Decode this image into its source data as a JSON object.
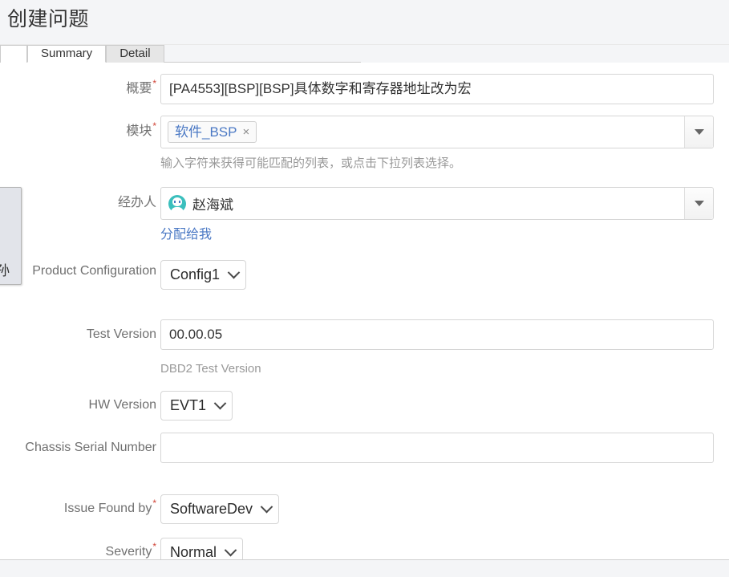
{
  "header": {
    "title": "创建问题"
  },
  "tabs": [
    {
      "label": "Summary",
      "active": true
    },
    {
      "label": "Detail",
      "active": false
    }
  ],
  "form": {
    "fields": [
      {
        "id": "summary",
        "label": "概要",
        "required": true,
        "type": "text",
        "value": "[PA4553][BSP][BSP]具体数字和寄存器地址改为宏",
        "placeholder": ""
      },
      {
        "id": "module",
        "label": "模块",
        "required": true,
        "type": "tokens",
        "chip": "软件_BSP",
        "chip_remove": "×",
        "hint": "输入字符来获得可能匹配的列表，或点击下拉列表选择。"
      },
      {
        "id": "assignee",
        "label": "经办人",
        "required": false,
        "type": "picker",
        "value": "赵海斌",
        "link": "分配给我"
      },
      {
        "id": "product-configuration",
        "label": "Product Configuration",
        "required": false,
        "type": "select",
        "value": "Config1"
      },
      {
        "id": "test-version",
        "label": "Test Version",
        "required": false,
        "type": "text",
        "value": "00.00.05",
        "hint": "DBD2 Test Version"
      },
      {
        "id": "hw-version",
        "label": "HW Version",
        "required": false,
        "type": "select",
        "value": "EVT1"
      },
      {
        "id": "chassis-serial-number",
        "label": "Chassis Serial Number",
        "required": false,
        "type": "text",
        "value": ""
      },
      {
        "id": "issue-found-by",
        "label": "Issue Found by",
        "required": true,
        "type": "select",
        "value": "SoftwareDev"
      },
      {
        "id": "severity",
        "label": "Severity",
        "required": true,
        "type": "select",
        "value": "Normal"
      }
    ]
  },
  "left_popup": {
    "text": "孙"
  },
  "colors": {
    "accent_link": "#4a78c4",
    "required_star": "#d04437",
    "avatar": "#3bbfbd",
    "chrome_bg": "#f4f5f7"
  }
}
